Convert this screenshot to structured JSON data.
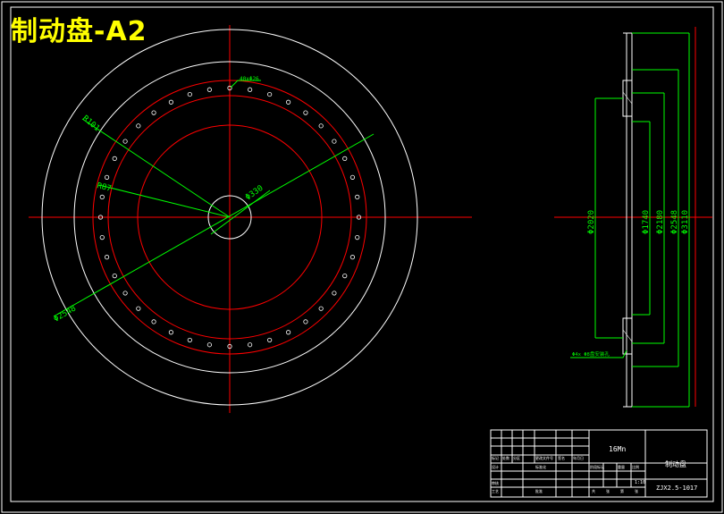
{
  "drawing": {
    "title": "制动盘-A2",
    "front_view": {
      "label_holes": "40xΦ26",
      "dim_r": "R101",
      "dim_r2": "R87",
      "dim_bore": "Φ330",
      "dim_outer_left": "Φ2548"
    },
    "side_view": {
      "dims": [
        "Φ2020",
        "Φ1740",
        "Φ2180",
        "Φ2548",
        "Φ3110"
      ],
      "label_bolt": "Φ4x Φ8盘安装孔"
    },
    "title_block": {
      "model": "16Mn",
      "part_name": "制动盘",
      "drawing_no": "ZJX2.5-1017",
      "scale": "1:10",
      "small_labels": [
        "标记",
        "处数",
        "分区",
        "更改文件号",
        "签名",
        "年月日",
        "设计",
        "标准化",
        "阶段标记",
        "重量",
        "比例",
        "审核",
        "工艺",
        "批准",
        "共",
        "张",
        "第",
        "张"
      ]
    }
  }
}
